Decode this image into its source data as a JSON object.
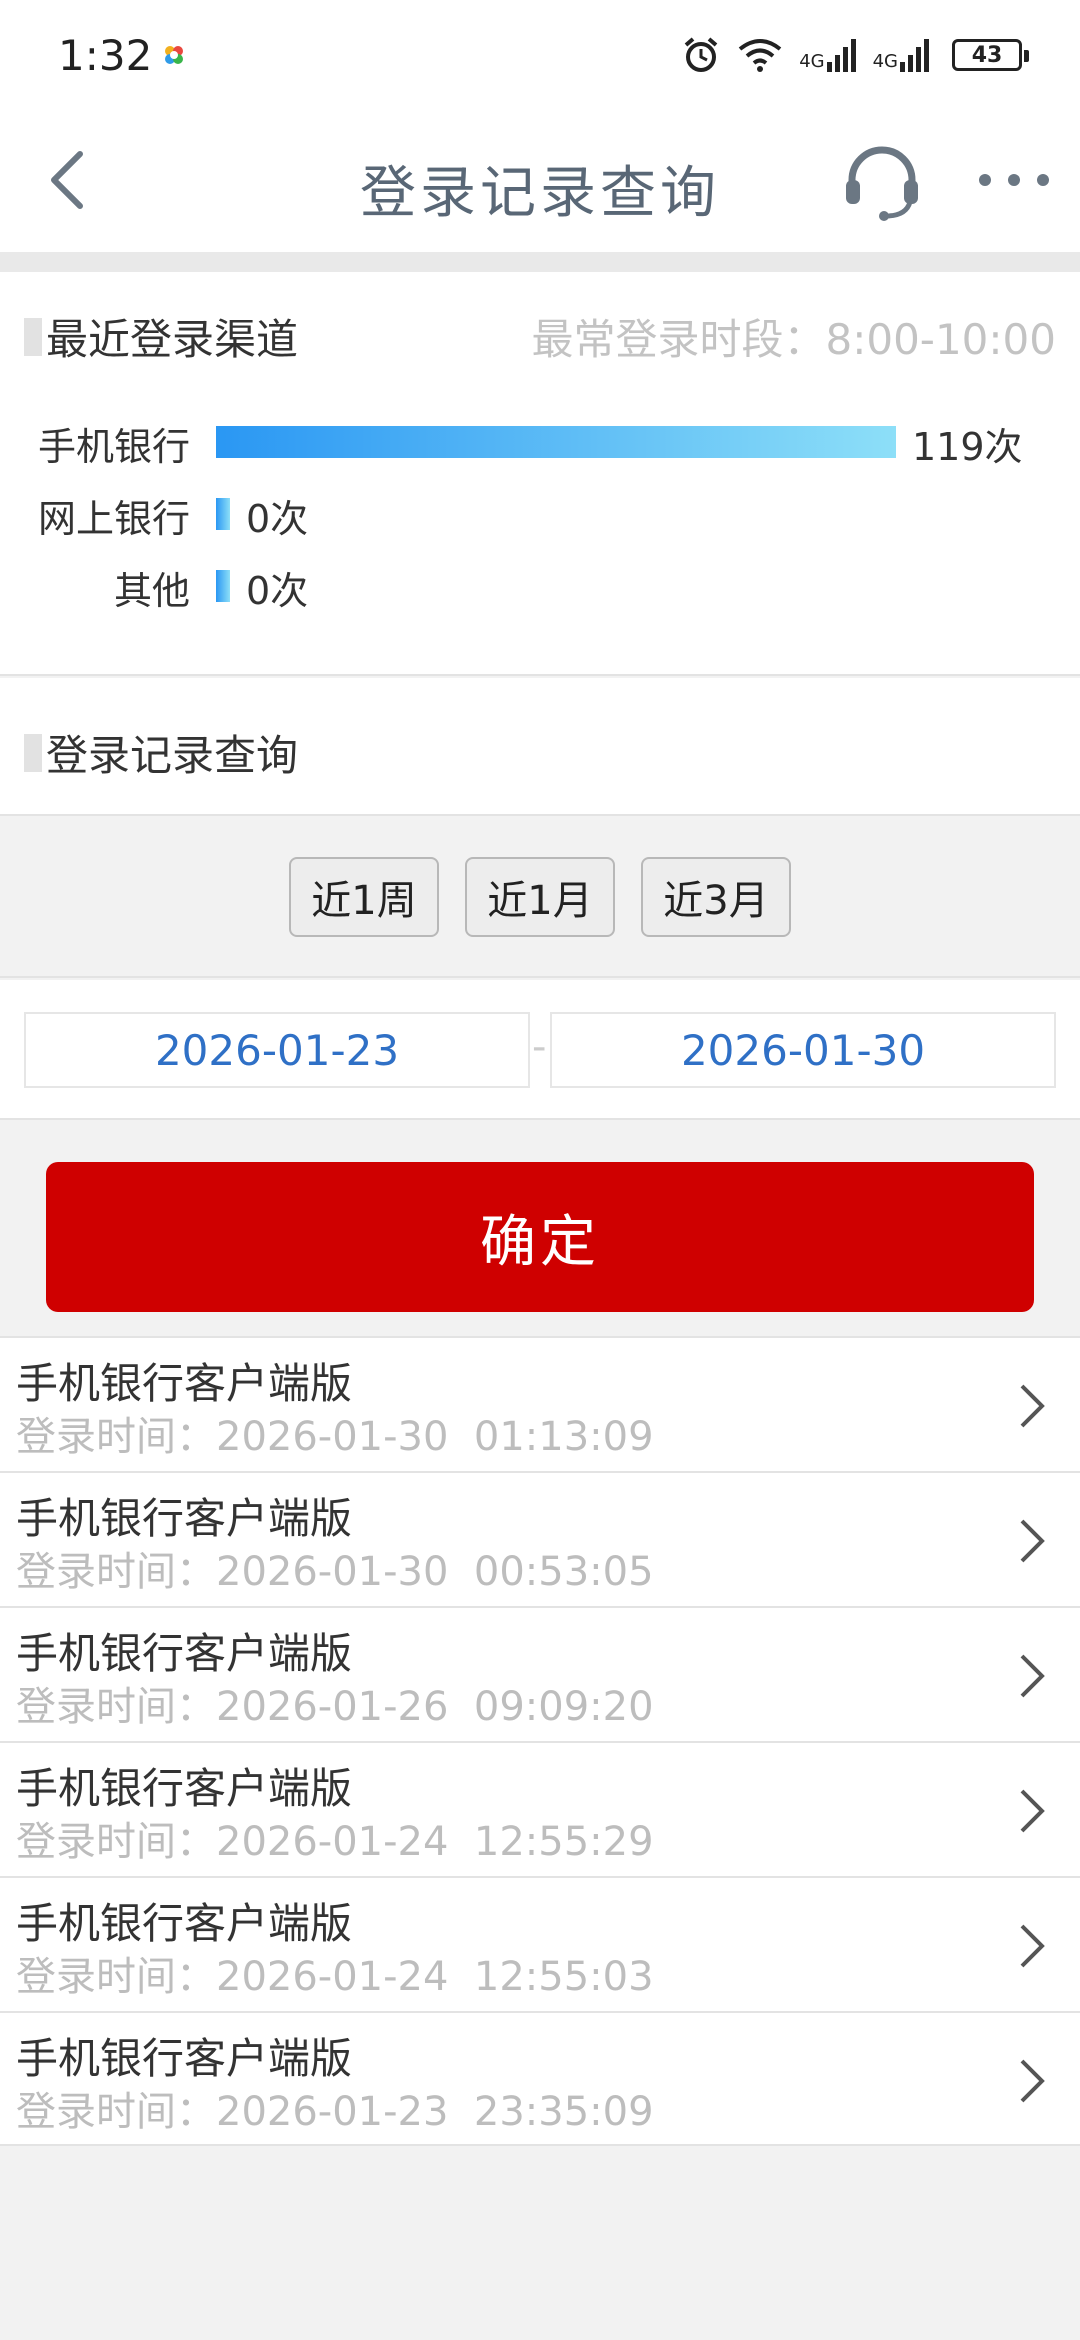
{
  "status_bar": {
    "time": "1:32",
    "signal_1": "4G",
    "signal_2": "4G",
    "battery": "43"
  },
  "nav": {
    "title": "登录记录查询",
    "icons": [
      "back-icon",
      "headset-icon",
      "more-icon"
    ]
  },
  "channels": {
    "title": "最近登录渠道",
    "frequent_label": "最常登录时段：",
    "frequent_value": "8:00-10:00",
    "items": [
      {
        "label": "手机银行",
        "count": 119,
        "count_text": "119次"
      },
      {
        "label": "网上银行",
        "count": 0,
        "count_text": "0次"
      },
      {
        "label": "其他",
        "count": 0,
        "count_text": "0次"
      }
    ],
    "bar_colors": [
      "#2a97f3",
      "#8ddff8"
    ]
  },
  "query": {
    "title": "登录记录查询",
    "ranges": [
      "近1周",
      "近1月",
      "近3月"
    ],
    "start_date": "2026-01-23",
    "end_date": "2026-01-30",
    "separator": "-",
    "confirm_label": "确定",
    "confirm_color": "#cf0000"
  },
  "records": [
    {
      "name": "手机银行客户端版",
      "time": "登录时间：2026-01-30  01:13:09"
    },
    {
      "name": "手机银行客户端版",
      "time": "登录时间：2026-01-30  00:53:05"
    },
    {
      "name": "手机银行客户端版",
      "time": "登录时间：2026-01-26  09:09:20"
    },
    {
      "name": "手机银行客户端版",
      "time": "登录时间：2026-01-24  12:55:29"
    },
    {
      "name": "手机银行客户端版",
      "time": "登录时间：2026-01-24  12:55:03"
    },
    {
      "name": "手机银行客户端版",
      "time": "登录时间：2026-01-23  23:35:09"
    }
  ]
}
